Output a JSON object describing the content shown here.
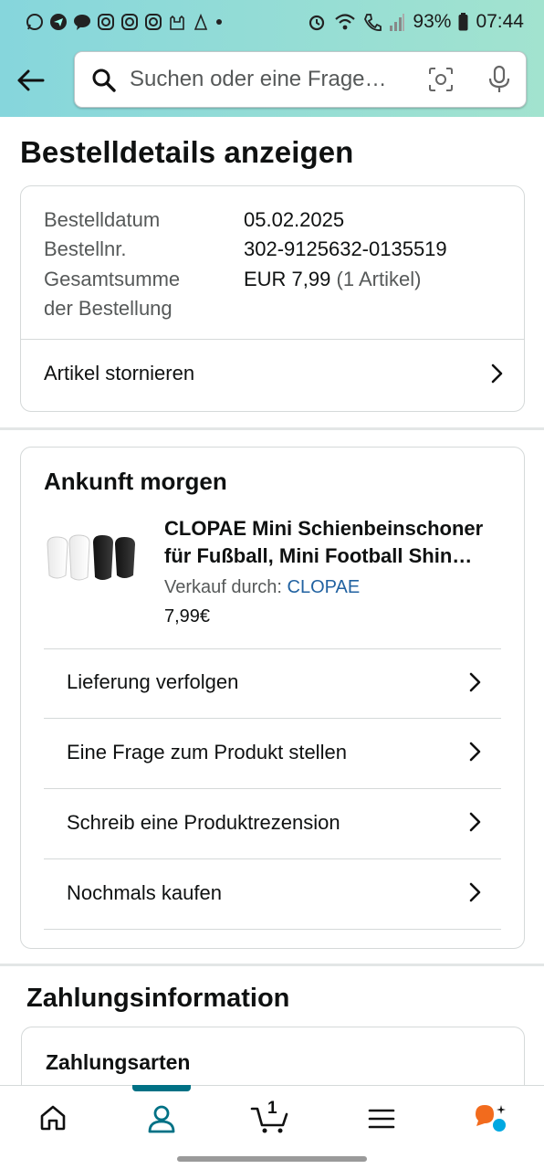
{
  "status_bar": {
    "battery": "93%",
    "time": "07:44"
  },
  "search": {
    "placeholder": "Suchen oder eine Frage…"
  },
  "page": {
    "title": "Bestelldetails anzeigen"
  },
  "order_summary": {
    "date_label": "Bestelldatum",
    "date_value": "05.02.2025",
    "number_label": "Bestellnr.",
    "number_value": "302-9125632-0135519",
    "total_label_line1": "Gesamtsumme",
    "total_label_line2": "der Bestellung",
    "total_value": "EUR 7,99",
    "total_count": "(1 Artikel)",
    "cancel_label": "Artikel stornieren"
  },
  "shipment": {
    "heading": "Ankunft morgen",
    "product_title_line1": "CLOPAE Mini Schienbeinschoner",
    "product_title_line2": "für Fußball, Mini Football Shin…",
    "seller_label": "Verkauf durch:",
    "seller_name": "CLOPAE",
    "price": "7,99€",
    "actions": [
      {
        "label": "Lieferung verfolgen"
      },
      {
        "label": "Eine Frage zum Produkt stellen"
      },
      {
        "label": "Schreib eine Produktrezension"
      },
      {
        "label": "Nochmals kaufen"
      }
    ]
  },
  "payment": {
    "heading": "Zahlungsinformation",
    "methods_label": "Zahlungsarten"
  },
  "bottom_nav": {
    "cart_count": "1",
    "items": [
      "home-icon",
      "account-icon",
      "cart-icon",
      "menu-icon",
      "rufus-icon"
    ]
  },
  "colors": {
    "header_start": "#86d6dc",
    "header_end": "#a2e3cf",
    "link": "#2162a1",
    "accent": "#007185"
  }
}
